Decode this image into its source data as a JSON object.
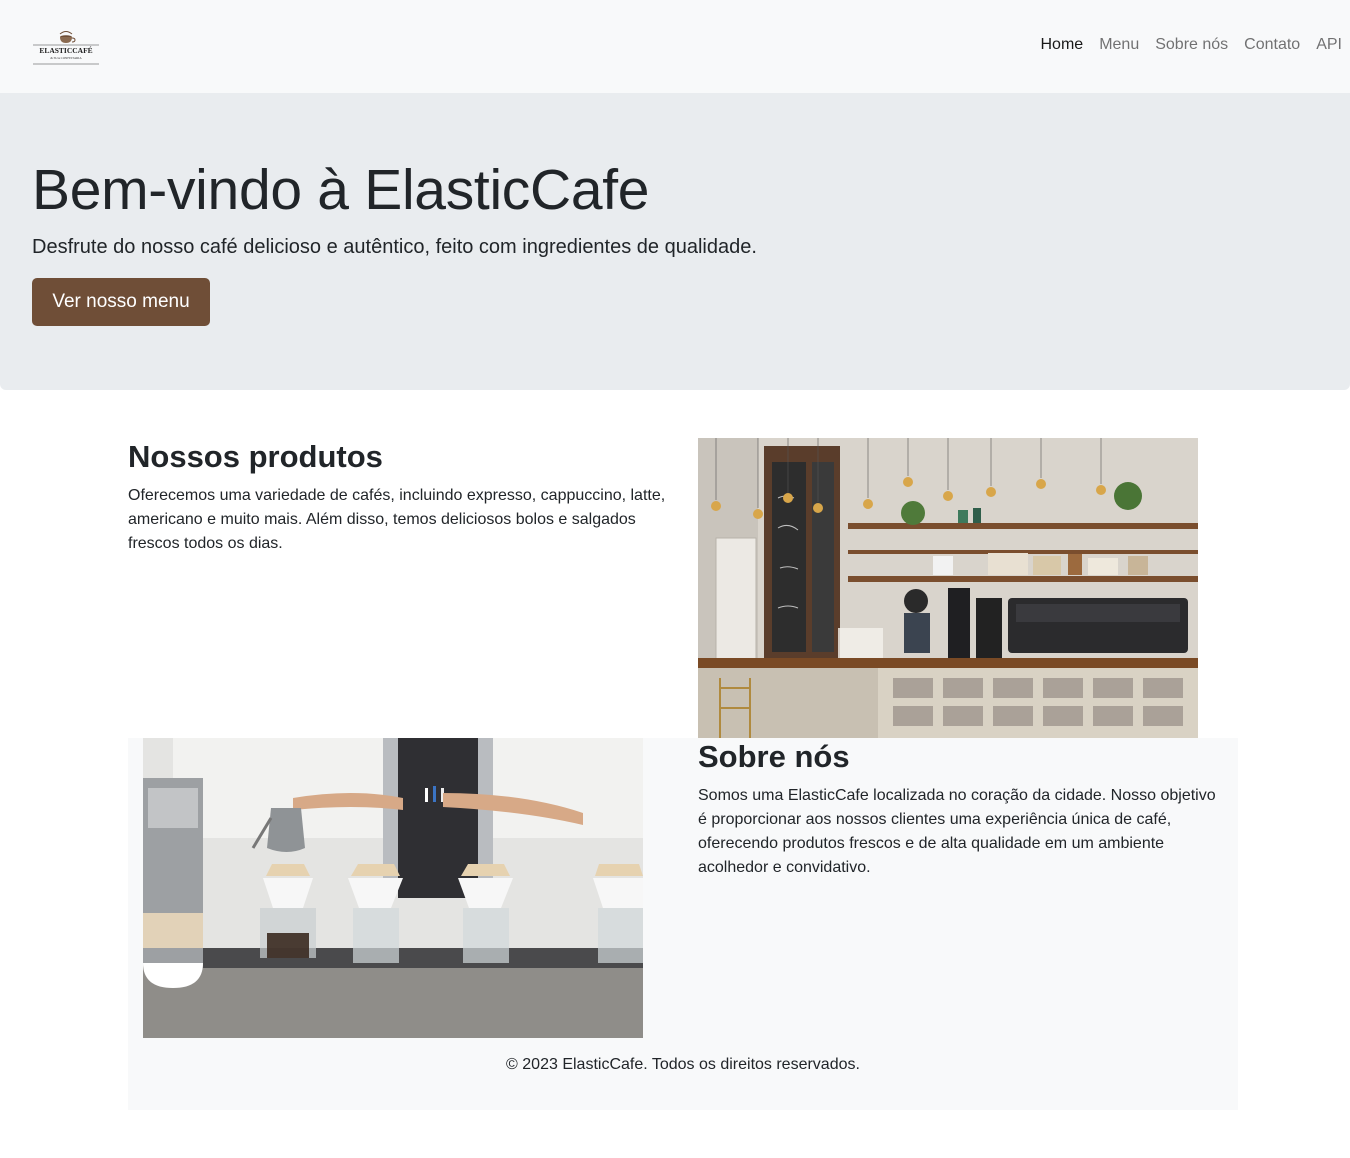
{
  "brand": {
    "logo_name": "ELASTICCAFÉ",
    "logo_tagline": "& SUA CONFEITARIA"
  },
  "nav": {
    "items": [
      {
        "label": "Home",
        "active": true
      },
      {
        "label": "Menu",
        "active": false
      },
      {
        "label": "Sobre nós",
        "active": false
      },
      {
        "label": "Contato",
        "active": false
      },
      {
        "label": "API",
        "active": false
      }
    ]
  },
  "hero": {
    "title": "Bem-vindo à ElasticCafe",
    "lead": "Desfrute do nosso café delicioso e autêntico, feito com ingredientes de qualidade.",
    "button_label": "Ver nosso menu"
  },
  "products": {
    "title": "Nossos produtos",
    "text": "Oferecemos uma variedade de cafés, incluindo expresso, cappuccino, latte, americano e muito mais. Além disso, temos deliciosos bolos e salgados frescos todos os dias."
  },
  "about": {
    "title": "Sobre nós",
    "text": "Somos uma ElasticCafe localizada no coração da cidade. Nosso objetivo é proporcionar aos nossos clientes uma experiência única de café, oferecendo produtos frescos e de alta qualidade em um ambiente acolhedor e convidativo."
  },
  "footer": {
    "text": "© 2023 ElasticCafe. Todos os direitos reservados."
  },
  "colors": {
    "navbar_bg": "#f8f9fa",
    "hero_bg": "#e9ecef",
    "button_bg": "#6f4e37",
    "text": "#212529"
  }
}
